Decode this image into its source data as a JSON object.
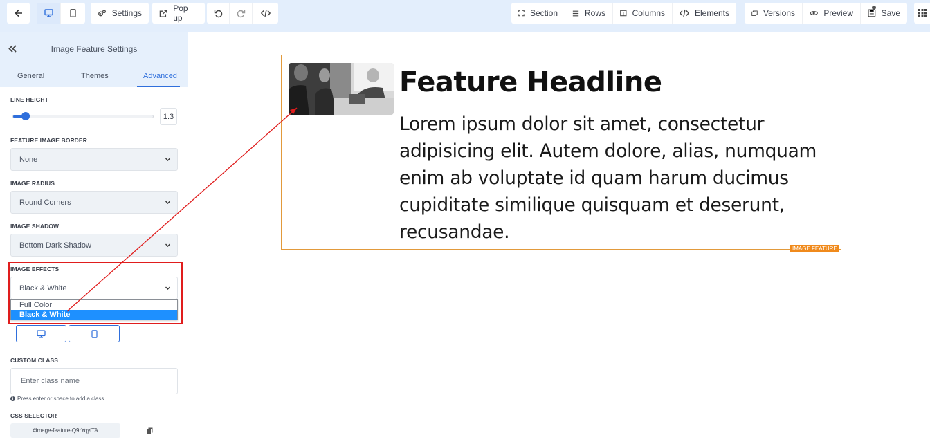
{
  "toolbar": {
    "settings_label": "Settings",
    "popup_label": "Pop up",
    "section_label": "Section",
    "rows_label": "Rows",
    "columns_label": "Columns",
    "elements_label": "Elements",
    "versions_label": "Versions",
    "preview_label": "Preview",
    "save_label": "Save"
  },
  "sidebar": {
    "title": "Image Feature Settings",
    "tabs": [
      {
        "label": "General"
      },
      {
        "label": "Themes"
      },
      {
        "label": "Advanced",
        "active": true
      }
    ],
    "line_height": {
      "label": "LINE HEIGHT",
      "value": "1.3",
      "fraction": 0.08
    },
    "feature_image_border": {
      "label": "FEATURE IMAGE BORDER",
      "value": "None"
    },
    "image_radius": {
      "label": "IMAGE RADIUS",
      "value": "Round Corners"
    },
    "image_shadow": {
      "label": "IMAGE SHADOW",
      "value": "Bottom Dark Shadow"
    },
    "image_effects": {
      "label": "IMAGE EFFECTS",
      "value": "Black & White",
      "options": [
        "Full Color",
        "Black & White"
      ]
    },
    "custom_class": {
      "label": "CUSTOM CLASS",
      "placeholder": "Enter class name",
      "hint": "Press enter or space to add a class"
    },
    "css_selector": {
      "label": "CSS SELECTOR",
      "value": "#image-feature-Q9rYqyiTA"
    }
  },
  "canvas": {
    "headline": "Feature Headline",
    "body_lines": [
      "Lorem ipsum dolor sit amet, consectetur",
      "adipisicing elit. Autem dolore, alias, numquam",
      "enim ab voluptate id quam harum ducimus",
      "cupiditate similique quisquam et deserunt,",
      "recusandae."
    ],
    "element_tag": "IMAGE FEATURE"
  },
  "colors": {
    "accent": "#2f6fdc",
    "highlight_border": "#e01d1d",
    "element_border": "#e29a3b",
    "tag_bg": "#f08a1c"
  }
}
